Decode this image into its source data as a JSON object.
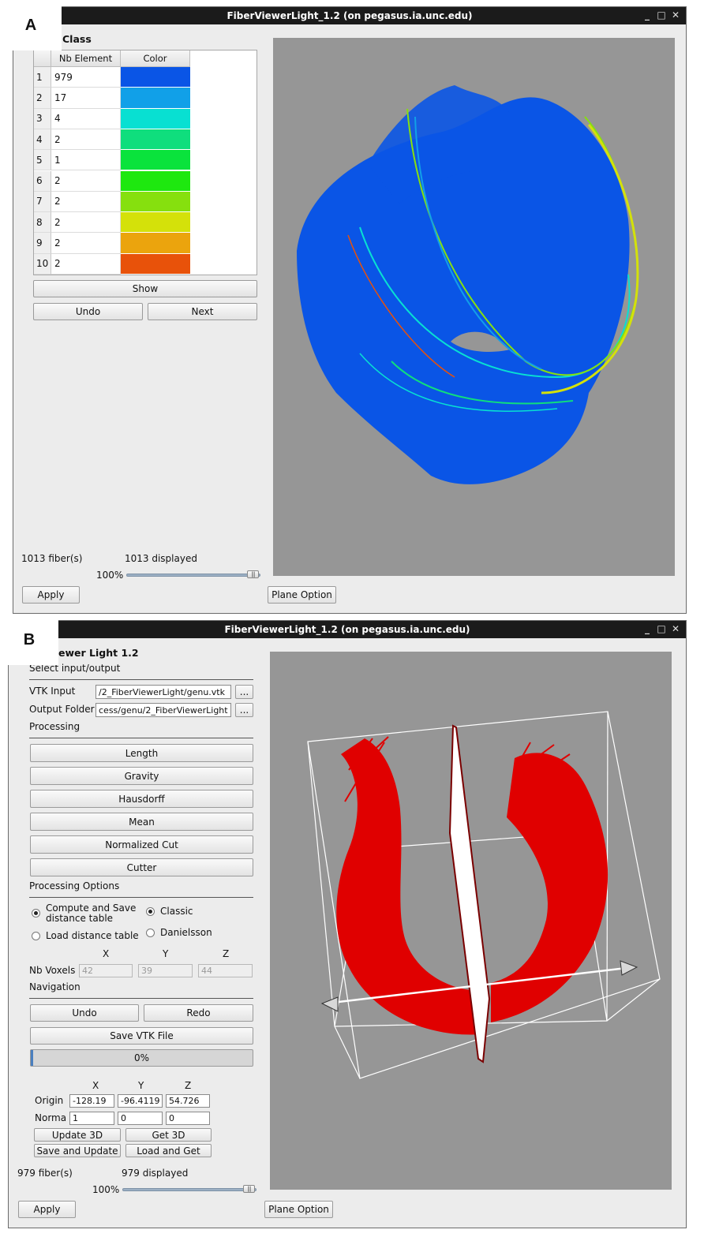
{
  "panelA": {
    "label": "A",
    "window_title": "FiberViewerLight_1.2 (on pegasus.ia.unc.edu)",
    "section_title": "Class",
    "table": {
      "col_nb": "Nb Element",
      "col_color": "Color",
      "rows": [
        {
          "n": "1",
          "nb": "979",
          "color": "#0a55e6"
        },
        {
          "n": "2",
          "nb": "17",
          "color": "#11a0e8"
        },
        {
          "n": "3",
          "nb": "4",
          "color": "#08e0d2"
        },
        {
          "n": "4",
          "nb": "2",
          "color": "#0fde7d"
        },
        {
          "n": "5",
          "nb": "1",
          "color": "#0ae33c"
        },
        {
          "n": "6",
          "nb": "2",
          "color": "#1ee80f"
        },
        {
          "n": "7",
          "nb": "2",
          "color": "#86e00e"
        },
        {
          "n": "8",
          "nb": "2",
          "color": "#d4e10a"
        },
        {
          "n": "9",
          "nb": "2",
          "color": "#eba40d"
        },
        {
          "n": "10",
          "nb": "2",
          "color": "#e8520a"
        }
      ]
    },
    "show": "Show",
    "undo": "Undo",
    "next": "Next",
    "fibers": "1013 fiber(s)",
    "displayed": "1013 displayed",
    "percent": "100%",
    "apply": "Apply",
    "plane_option": "Plane Option"
  },
  "panelB": {
    "label": "B",
    "window_title": "FiberViewerLight_1.2 (on pegasus.ia.unc.edu)",
    "section_title": "ewer Light 1.2",
    "io_title": "Select input/output",
    "vtk_input_label": "VTK Input",
    "vtk_input_value": "/2_FiberViewerLight/genu.vtk",
    "output_folder_label": "Output Folder",
    "output_folder_value": "cess/genu/2_FiberViewerLight",
    "browse": "...",
    "processing_title": "Processing",
    "methods": [
      "Length",
      "Gravity",
      "Hausdorff",
      "Mean",
      "Normalized Cut",
      "Cutter"
    ],
    "options_title": "Processing Options",
    "opt_compute": "Compute and Save distance table",
    "opt_load": "Load distance table",
    "opt_classic": "Classic",
    "opt_danielsson": "Danielsson",
    "x": "X",
    "y": "Y",
    "z": "Z",
    "nb_voxels_label": "Nb Voxels",
    "voxels": [
      "42",
      "39",
      "44"
    ],
    "navigation_title": "Navigation",
    "undo": "Undo",
    "redo": "Redo",
    "save_vtk": "Save VTK File",
    "progress_text": "0%",
    "progress": 0.01,
    "origin_label": "Origin",
    "origin": [
      "-128.19",
      "-96.4119",
      "54.726"
    ],
    "normal_label": "Norma",
    "normal": [
      "1",
      "0",
      "0"
    ],
    "update3d": "Update 3D",
    "get3d": "Get 3D",
    "save_update": "Save and Update",
    "load_get": "Load and Get",
    "fibers": "979 fiber(s)",
    "displayed": "979 displayed",
    "percent": "100%",
    "apply": "Apply",
    "plane_option": "Plane Option"
  },
  "colors": {
    "fiber_blue": "#0a55e6",
    "fiber_red": "#e00000",
    "viewport_bg": "#969696"
  }
}
